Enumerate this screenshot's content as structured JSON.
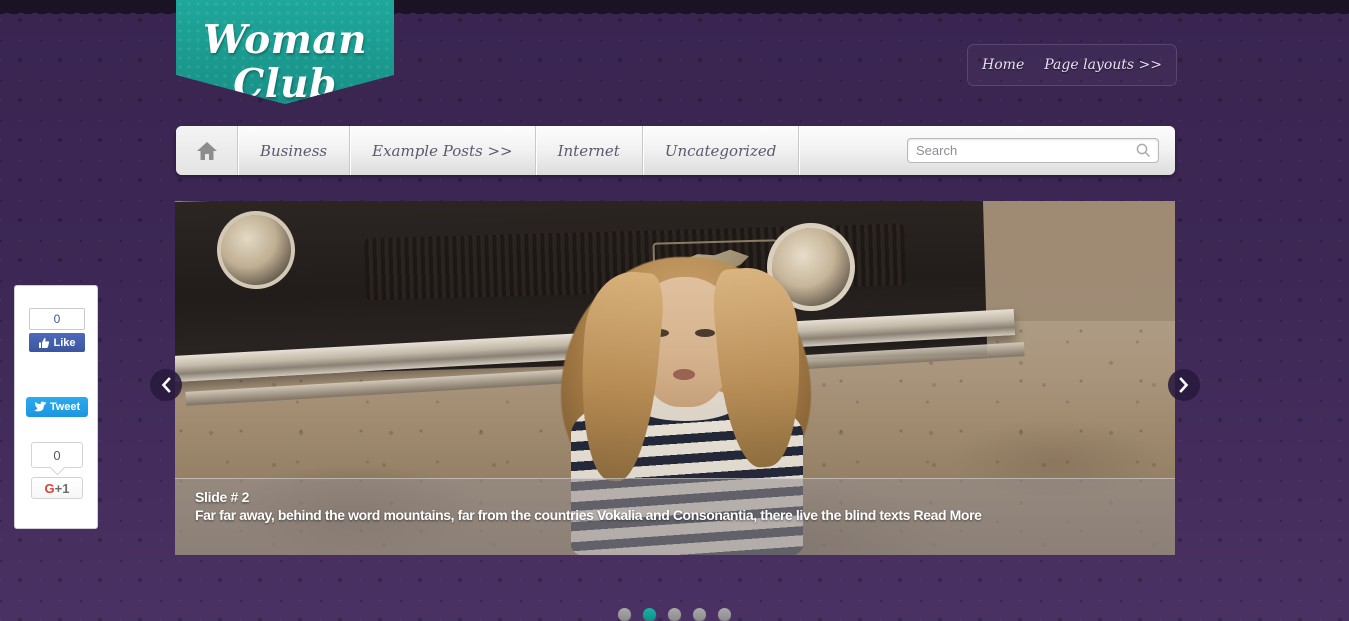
{
  "site": {
    "logo_text": "Woman Club",
    "ornament_icon": "floral-ornament-icon"
  },
  "topnav": {
    "items": [
      {
        "label": "Home"
      },
      {
        "label": "Page layouts >>"
      }
    ]
  },
  "menubar": {
    "home_icon": "home-icon",
    "items": [
      {
        "label": "Business"
      },
      {
        "label": "Example Posts >>"
      },
      {
        "label": "Internet"
      },
      {
        "label": "Uncategorized"
      }
    ],
    "search": {
      "placeholder": "Search",
      "value": "",
      "icon": "search-icon"
    }
  },
  "slider": {
    "caption_title": "Slide # 2",
    "caption_text": "Far far away, behind the word mountains, far from the countries Vokalia and Consonantia, there live the blind texts Read More",
    "prev_icon": "chevron-left-icon",
    "next_icon": "chevron-right-icon",
    "dots": [
      {
        "active": false
      },
      {
        "active": true
      },
      {
        "active": false
      },
      {
        "active": false
      },
      {
        "active": false
      }
    ]
  },
  "social": {
    "facebook": {
      "count": "0",
      "label": "Like",
      "icon": "thumbs-up-icon",
      "color": "#3b5998"
    },
    "twitter": {
      "label": "Tweet",
      "icon": "twitter-bird-icon",
      "color": "#1b95e0"
    },
    "googleplus": {
      "count": "0",
      "g_label": "G",
      "plus_label": "+1",
      "color": "#d94235"
    }
  },
  "colors": {
    "background": "#3a2551",
    "accent_teal": "#17b3a6",
    "topbar": "#1b1226"
  }
}
